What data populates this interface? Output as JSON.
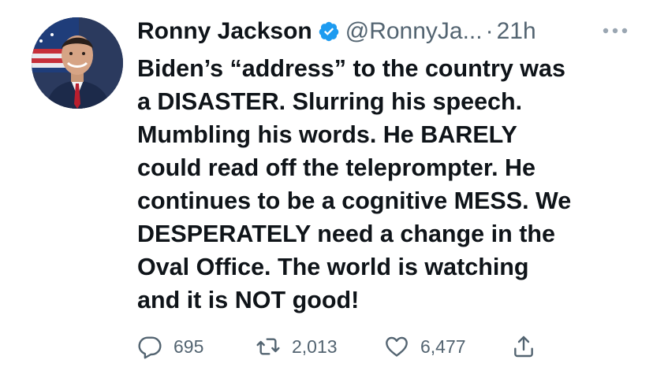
{
  "tweet": {
    "author_name": "Ronny Jackson",
    "verified_icon": "verified-badge-icon",
    "handle": "@RonnyJa...",
    "separator": "·",
    "time": "21h",
    "more_icon": "more-options-icon",
    "text": "Biden’s “address” to the country was\na DISASTER. Slurring his speech.\nMumbling his words. He BARELY\ncould read off the teleprompter. He\ncontinues to be a cognitive MESS. We\nDESPERATELY need a change in the\nOval Office. The world is watching\nand it is NOT good!",
    "replies": "695",
    "retweets": "2,013",
    "likes": "6,477"
  },
  "colors": {
    "text": "#0f1419",
    "secondary": "#536471",
    "verified": "#1d9bf0",
    "background": "#ffffff"
  }
}
